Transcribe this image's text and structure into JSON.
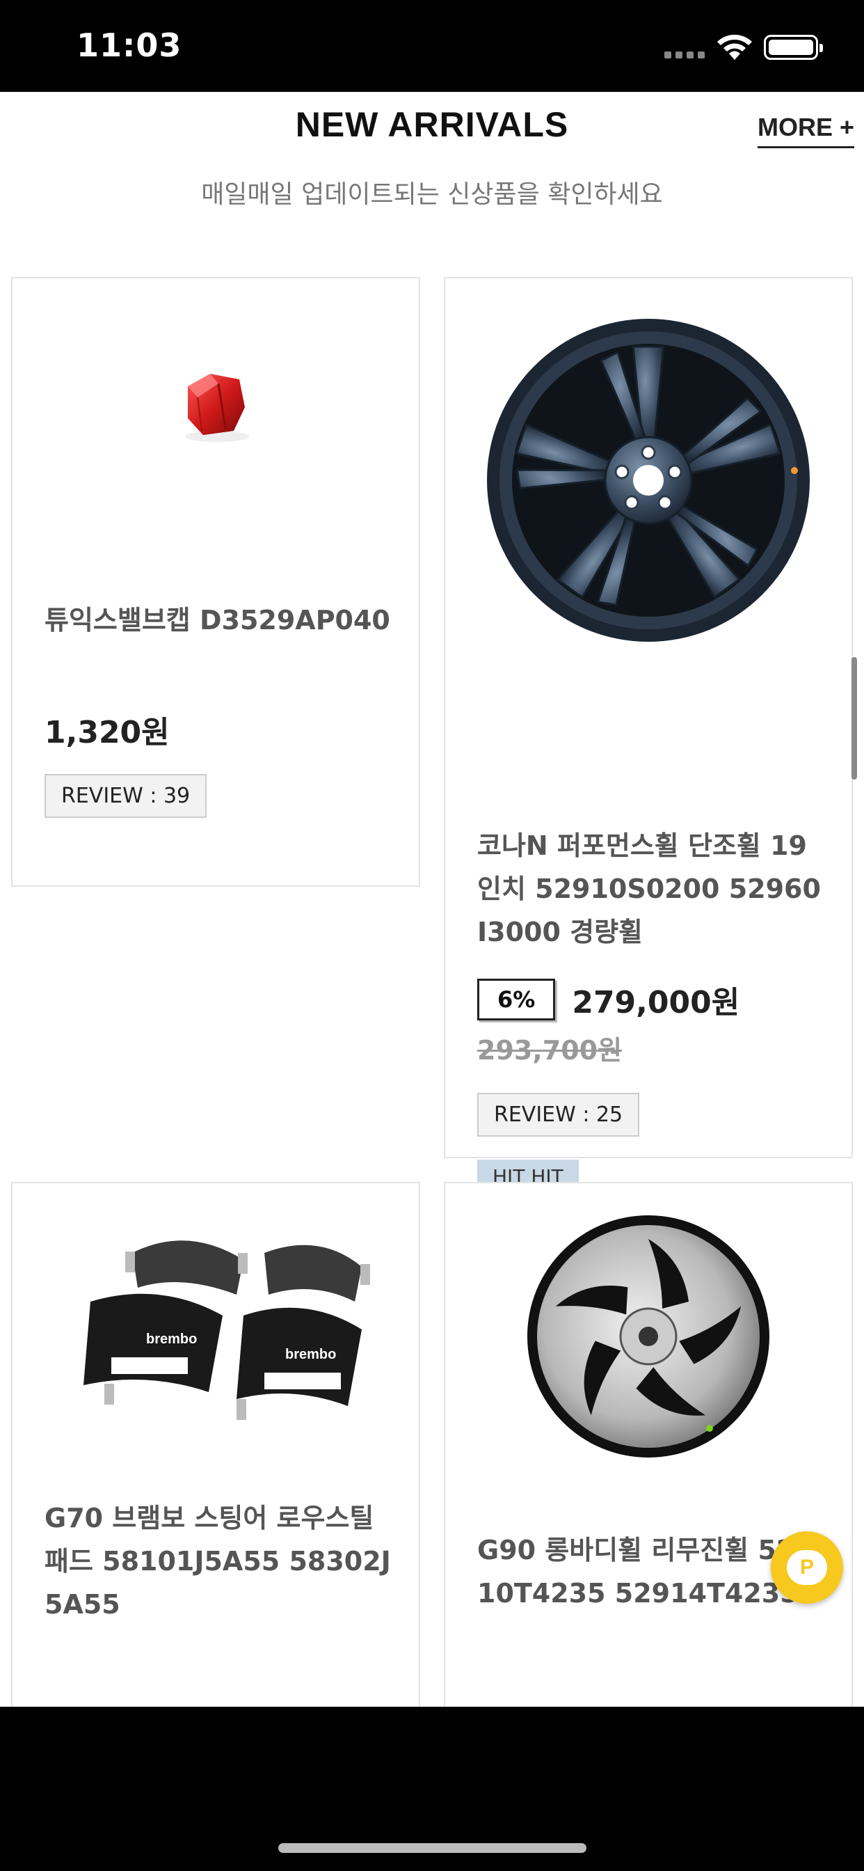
{
  "status_bar": {
    "time": "11:03"
  },
  "section": {
    "title": "NEW ARRIVALS",
    "more": "MORE +",
    "subtitle": "매일매일 업데이트되는 신상품을 확인하세요"
  },
  "products": [
    {
      "name": "튜익스밸브캡 D3529AP040",
      "price": "1,320원",
      "review": "REVIEW : 39",
      "image": "red-valve-cap"
    },
    {
      "name": "코나N 퍼포먼스휠 단조휠 19인치 52910S0200 52960I3000 경량휠",
      "discount": "6%",
      "price": "279,000원",
      "original_price": "293,700원",
      "review": "REVIEW : 25",
      "badge": "HIT HIT",
      "image": "dark-blue-wheel"
    },
    {
      "name": "G70 브램보 스팅어 로우스틸 패드 58101J5A55 58302J5A55",
      "image": "brake-pads"
    },
    {
      "name": "G90 롱바디휠 리무진휠 52910T4235 52914T4235",
      "image": "machined-wheel"
    }
  ],
  "colors": {
    "accent": "#f7c81e",
    "hit_badge": "#c9d8e6",
    "border": "#e3e3e3"
  }
}
